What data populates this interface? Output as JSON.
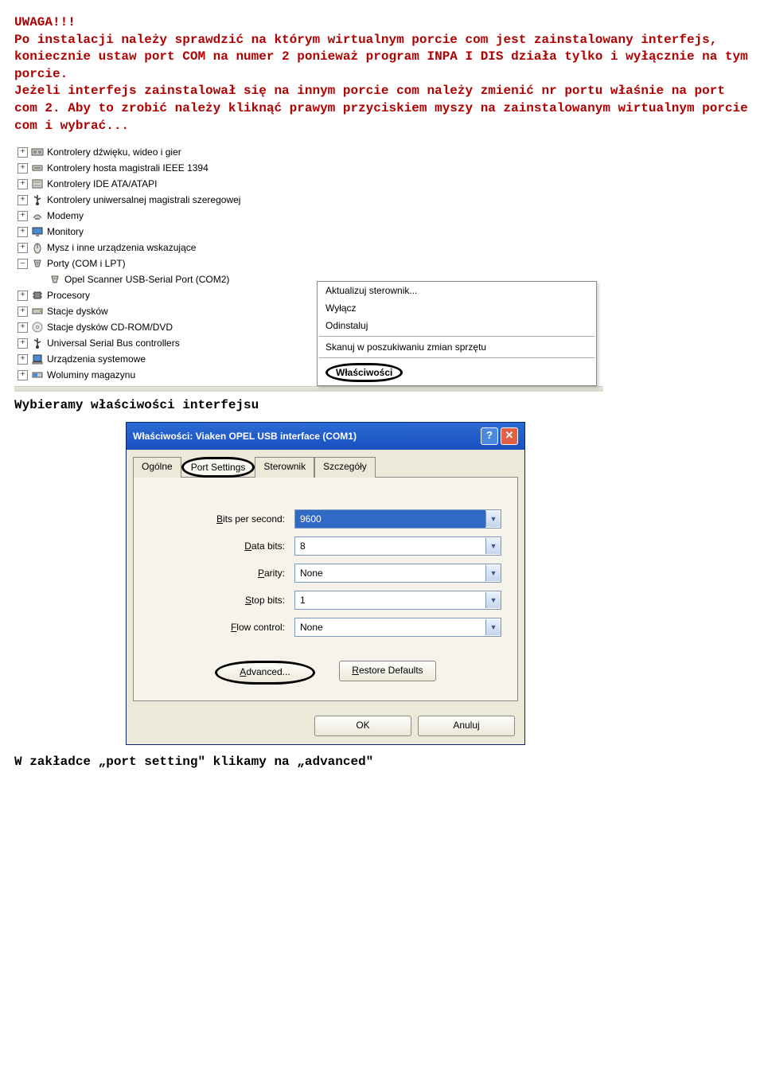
{
  "text": {
    "uwaga": "UWAGA!!!",
    "para1": "Po instalacji należy sprawdzić na którym wirtualnym porcie com jest zainstalowany interfejs, koniecznie ustaw port COM na numer 2 ponieważ program INPA I DIS działa tylko i wyłącznie na tym porcie.",
    "para2": "Jeżeli interfejs zainstalował się na innym porcie com należy zmienić nr portu właśnie na port com 2. Aby to zrobić należy kliknąć prawym przyciskiem myszy na zainstalowanym wirtualnym porcie com i wybrać...",
    "mid": "Wybieramy właściwości interfejsu",
    "bottom": "W zakładce „port setting\" klikamy na „advanced\""
  },
  "tree": {
    "items": [
      "Kontrolery dźwięku, wideo i gier",
      "Kontrolery hosta magistrali IEEE 1394",
      "Kontrolery IDE ATA/ATAPI",
      "Kontrolery uniwersalnej magistrali szeregowej",
      "Modemy",
      "Monitory",
      "Mysz i inne urządzenia wskazujące",
      "Porty (COM i LPT)"
    ],
    "child": "Opel Scanner USB-Serial Port (COM2)",
    "rest": [
      "Procesory",
      "Stacje dysków",
      "Stacje dysków CD-ROM/DVD",
      "Universal Serial Bus controllers",
      "Urządzenia systemowe",
      "Woluminy magazynu"
    ]
  },
  "menu": {
    "update": "Aktualizuj sterownik...",
    "disable": "Wyłącz",
    "uninstall": "Odinstaluj",
    "scan": "Skanuj w poszukiwaniu zmian sprzętu",
    "props": "Właściwości"
  },
  "dialog": {
    "title": "Właściwości: Viaken OPEL USB interface (COM1)",
    "tabs": {
      "general": "Ogólne",
      "port": "Port Settings",
      "driver": "Sterownik",
      "details": "Szczegóły"
    },
    "fields": {
      "bps_label": "Bits per second:",
      "bps_value": "9600",
      "databits_label": "Data bits:",
      "databits_value": "8",
      "parity_label": "Parity:",
      "parity_value": "None",
      "stopbits_label": "Stop bits:",
      "stopbits_value": "1",
      "flow_label": "Flow control:",
      "flow_value": "None"
    },
    "buttons": {
      "advanced": "Advanced...",
      "restore": "Restore Defaults",
      "ok": "OK",
      "cancel": "Anuluj"
    }
  }
}
